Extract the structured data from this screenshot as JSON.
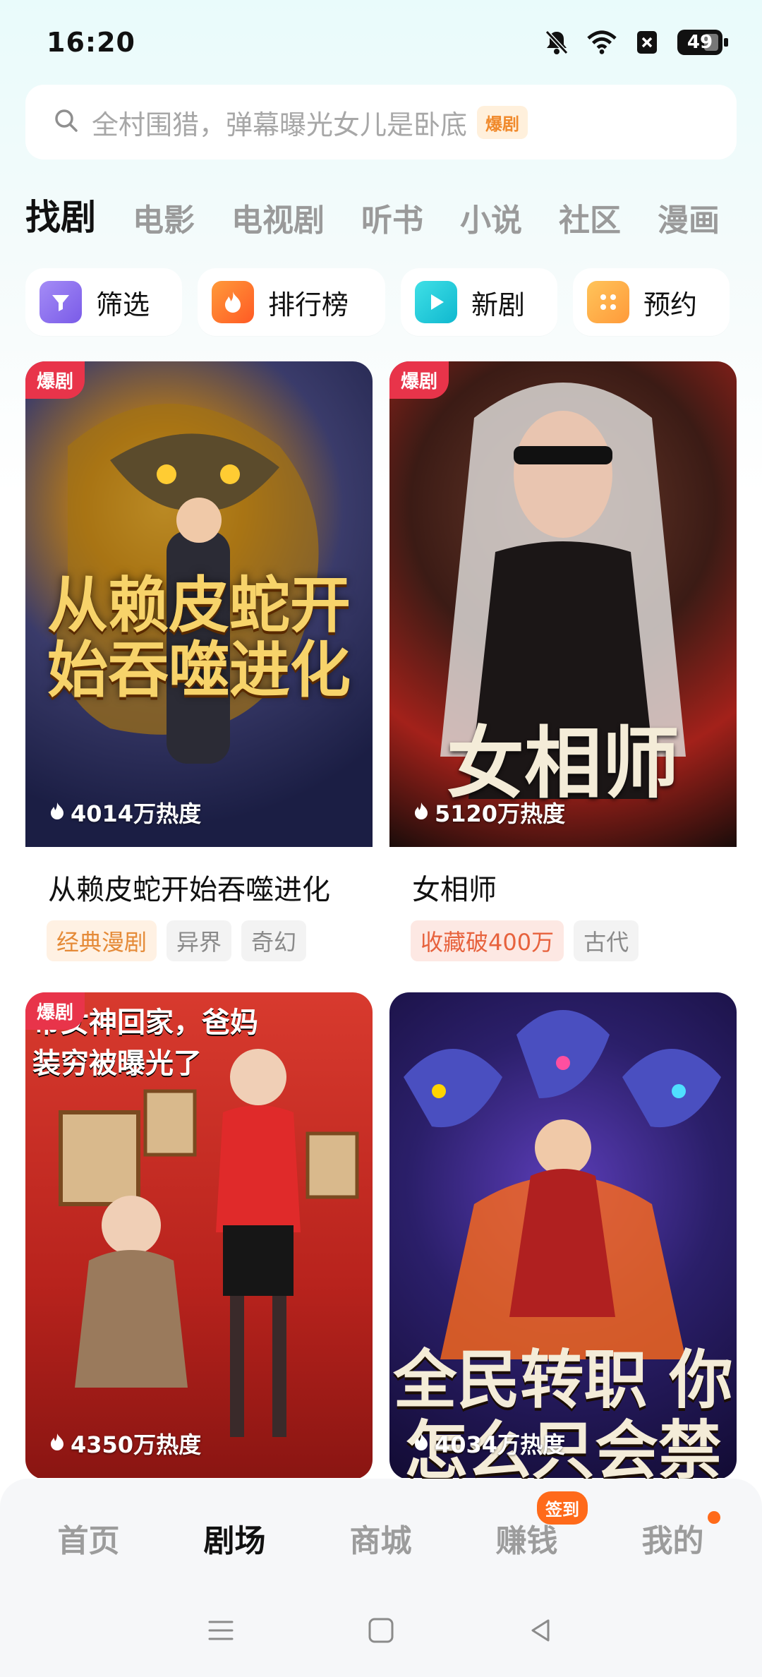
{
  "status_bar": {
    "time": "16:20",
    "battery": "49"
  },
  "search": {
    "placeholder": "全村围猎，弹幕曝光女儿是卧底",
    "tag": "爆剧"
  },
  "tabs": [
    "找剧",
    "电影",
    "电视剧",
    "听书",
    "小说",
    "社区",
    "漫画"
  ],
  "quick_actions": [
    {
      "label": "筛选",
      "icon": "filter-icon",
      "color": "#8b6cf0"
    },
    {
      "label": "排行榜",
      "icon": "fire-icon",
      "color": "#ff6a2a"
    },
    {
      "label": "新剧",
      "icon": "play-icon",
      "color": "#19c6d6"
    },
    {
      "label": "预约",
      "icon": "grid-dots-icon",
      "color": "#ffa23a"
    }
  ],
  "cards": [
    {
      "badge": "爆剧",
      "poster_text": "从赖皮蛇开始吞噬进化",
      "heat": "4014万热度",
      "title": "从赖皮蛇开始吞噬进化",
      "tags": [
        "经典漫剧",
        "异界",
        "奇幻"
      ]
    },
    {
      "badge": "爆剧",
      "poster_text": "女相师",
      "heat": "5120万热度",
      "title": "女相师",
      "tags": [
        "收藏破400万",
        "古代"
      ]
    },
    {
      "badge": "爆剧",
      "poster_text": "带女神回家，爸妈装穷被曝光了",
      "heat": "4350万热度"
    },
    {
      "badge": "",
      "poster_text": "全民转职 你怎么只会禁咒",
      "heat": "4034万热度"
    }
  ],
  "bottom_nav": {
    "items": [
      "首页",
      "剧场",
      "商城",
      "赚钱",
      "我的"
    ],
    "earn_badge": "签到"
  },
  "colors": {
    "accent": "#ff6a1a",
    "badge_red": "#e8344a"
  }
}
